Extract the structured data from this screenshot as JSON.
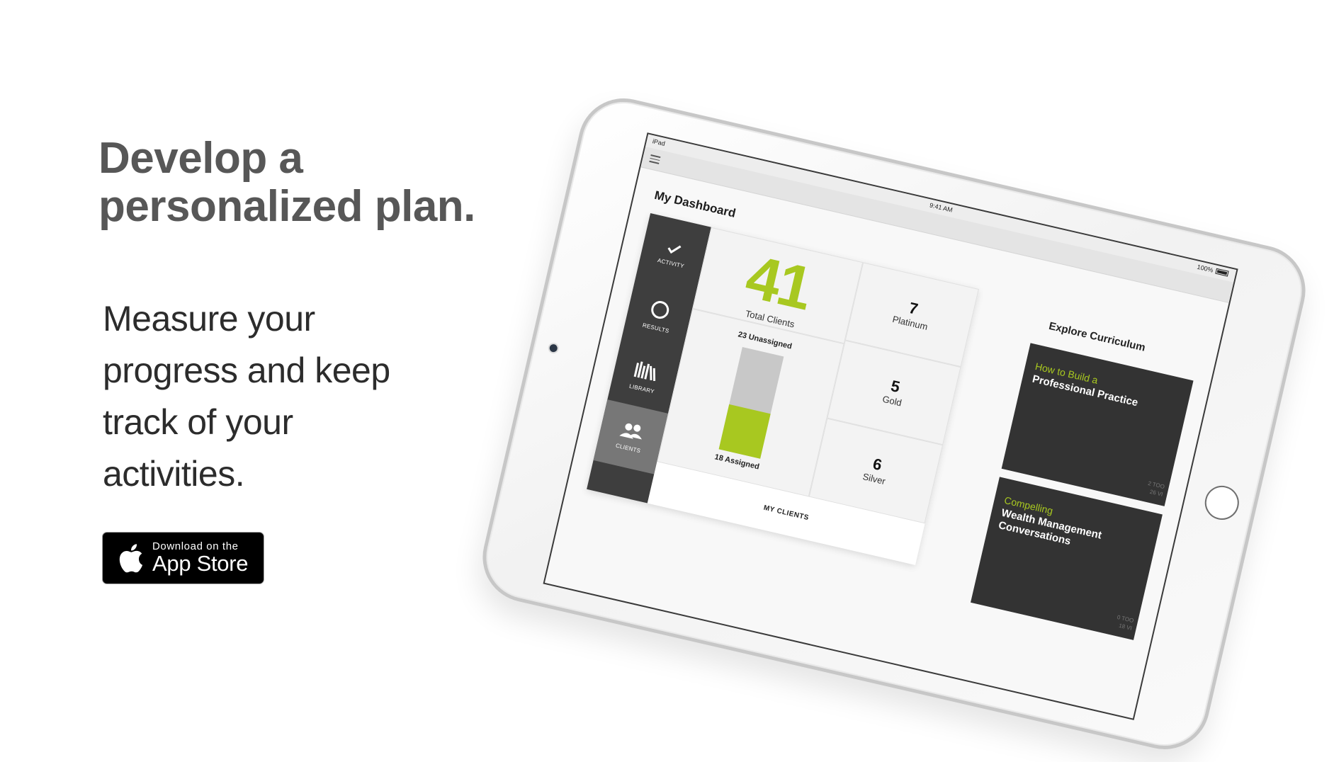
{
  "headline": {
    "line1": "Develop a",
    "line2": "personalized plan."
  },
  "subcopy": {
    "lines": [
      "Measure your",
      "progress and keep",
      "track of your",
      "activities."
    ]
  },
  "app_store_badge": {
    "small": "Download on the",
    "big": "App Store"
  },
  "device": {
    "status": {
      "carrier": "iPad",
      "time": "9:41 AM",
      "battery": "100%"
    },
    "dashboard": {
      "title": "My Dashboard",
      "rail": [
        {
          "label": "ACTIVITY",
          "icon": "check-icon"
        },
        {
          "label": "RESULTS",
          "icon": "ring-icon"
        },
        {
          "label": "LIBRARY",
          "icon": "books-icon"
        },
        {
          "label": "CLIENTS",
          "icon": "people-icon"
        }
      ],
      "total_clients": {
        "value": "41",
        "label": "Total Clients"
      },
      "unassigned_label": "23 Unassigned",
      "assigned_label": "18 Assigned",
      "assigned_fraction": 0.439,
      "tiers": [
        {
          "value": "7",
          "label": "Platinum"
        },
        {
          "value": "5",
          "label": "Gold"
        },
        {
          "value": "6",
          "label": "Silver"
        }
      ],
      "footer": "MY CLIENTS"
    },
    "curriculum": {
      "title": "Explore Curriculum",
      "courses": [
        {
          "accent": "How to Build a",
          "title": "Professional Practice",
          "meta1": "2 TOO",
          "meta2": "26 VI"
        },
        {
          "accent": "Compelling",
          "title": "Wealth Management Conversations",
          "meta1": "0 TOO",
          "meta2": "18 VI"
        }
      ]
    }
  },
  "colors": {
    "accent": "#a8c820",
    "rail": "#3e3e3e",
    "course_bg": "#333333",
    "headline": "#575757"
  }
}
